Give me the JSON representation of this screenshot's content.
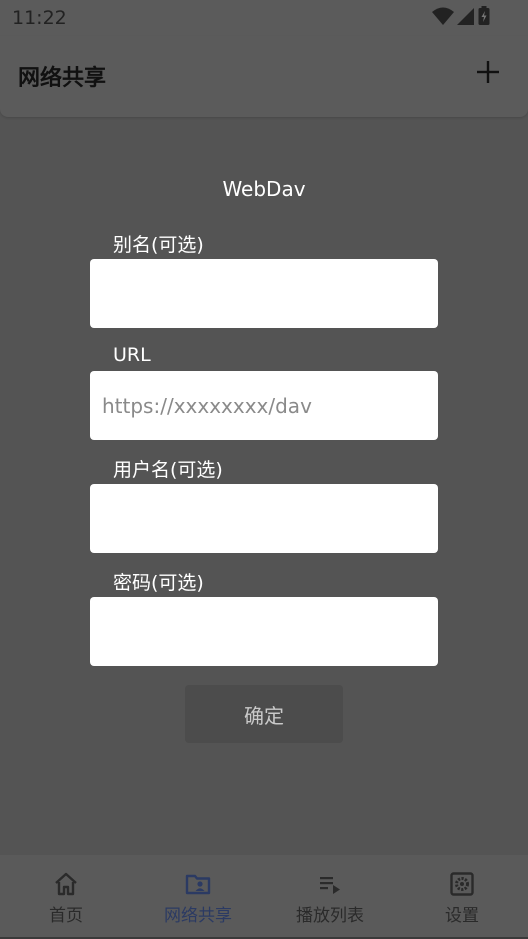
{
  "status_bar": {
    "time": "11:22"
  },
  "app_bar": {
    "title": "网络共享"
  },
  "form": {
    "title": "WebDav",
    "fields": [
      {
        "label": "别名(可选)",
        "placeholder": "",
        "value": ""
      },
      {
        "label": "URL",
        "placeholder": "https://xxxxxxxx/dav",
        "value": ""
      },
      {
        "label": "用户名(可选)",
        "placeholder": "",
        "value": ""
      },
      {
        "label": "密码(可选)",
        "placeholder": "",
        "value": ""
      }
    ],
    "confirm_label": "确定"
  },
  "bottom_nav": {
    "items": [
      {
        "label": "首页",
        "icon": "home-icon"
      },
      {
        "label": "网络共享",
        "icon": "folder-user-icon",
        "active": true
      },
      {
        "label": "播放列表",
        "icon": "playlist-icon"
      },
      {
        "label": "设置",
        "icon": "settings-icon"
      }
    ]
  },
  "colors": {
    "active": "#2b3a63",
    "inactive": "#2a2a2a"
  }
}
